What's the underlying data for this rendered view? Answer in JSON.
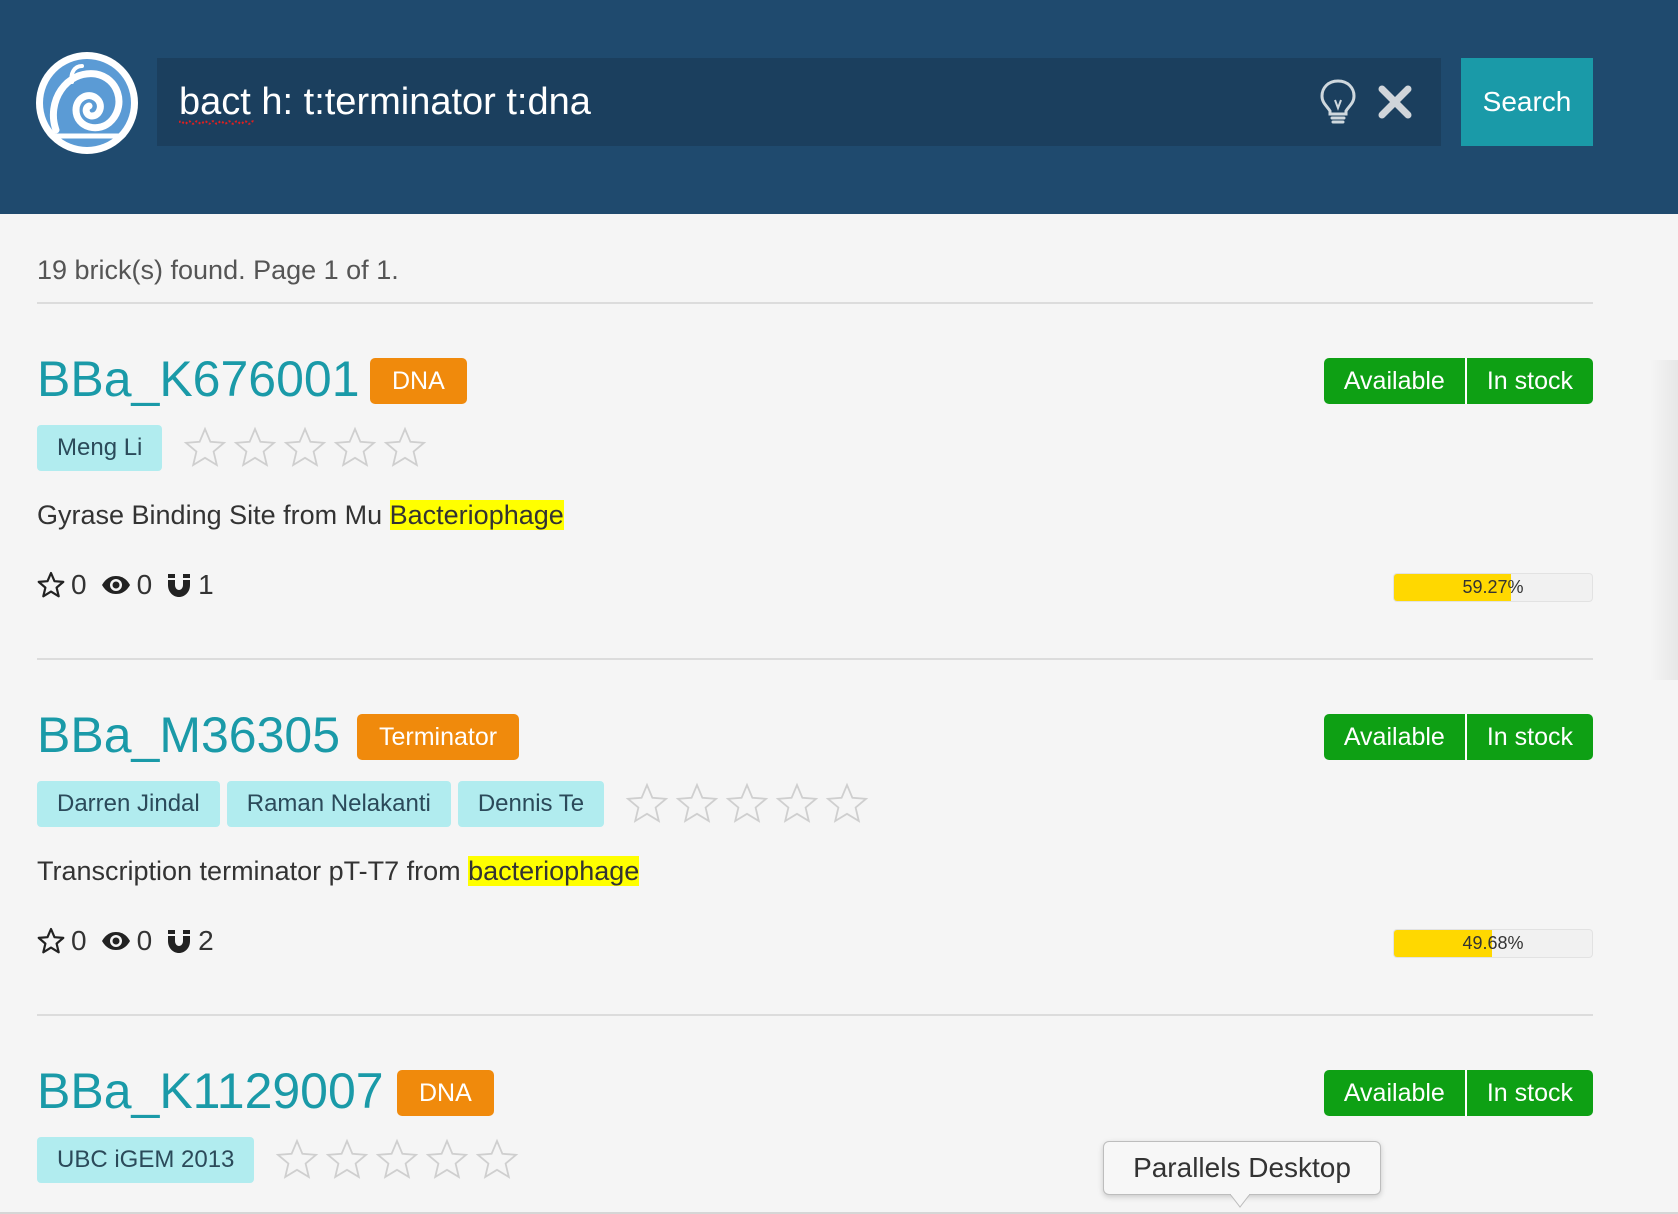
{
  "search": {
    "query": "bact h: t:terminator t:dna",
    "button_label": "Search",
    "hint_icon": "lightbulb-icon",
    "clear_icon": "close-icon"
  },
  "results": {
    "summary": "19 brick(s) found. Page 1 of 1."
  },
  "bricks": [
    {
      "name": "BBa_K676001",
      "type": "DNA",
      "availability": "Available",
      "stock": "In stock",
      "authors": [
        "Meng Li"
      ],
      "description_prefix": "Gyrase Binding Site from Mu ",
      "description_highlight": "Bacteriophage",
      "stars_count": "0",
      "views_count": "0",
      "uses_count": "1",
      "progress_value": 59.27,
      "progress_label": "59.27%"
    },
    {
      "name": "BBa_M36305",
      "type": "Terminator",
      "availability": "Available",
      "stock": "In stock",
      "authors": [
        "Darren Jindal",
        "Raman Nelakanti",
        "Dennis Te"
      ],
      "description_prefix": "Transcription terminator pT-T7 from ",
      "description_highlight": "bacteriophage",
      "stars_count": "0",
      "views_count": "0",
      "uses_count": "2",
      "progress_value": 49.68,
      "progress_label": "49.68%"
    },
    {
      "name": "BBa_K1129007",
      "type": "DNA",
      "availability": "Available",
      "stock": "In stock",
      "authors": [
        "UBC iGEM 2013"
      ]
    }
  ],
  "tooltip": {
    "text": "Parallels Desktop"
  },
  "colors": {
    "header": "#1f4a6e",
    "search_bg": "#1b3f5e",
    "accent": "#1a9aa8",
    "type_badge": "#f08a0c",
    "status_green": "#0ea014",
    "author_chip": "#b1ecef",
    "highlight": "#ffff00",
    "progress_fill": "#ffd800"
  }
}
